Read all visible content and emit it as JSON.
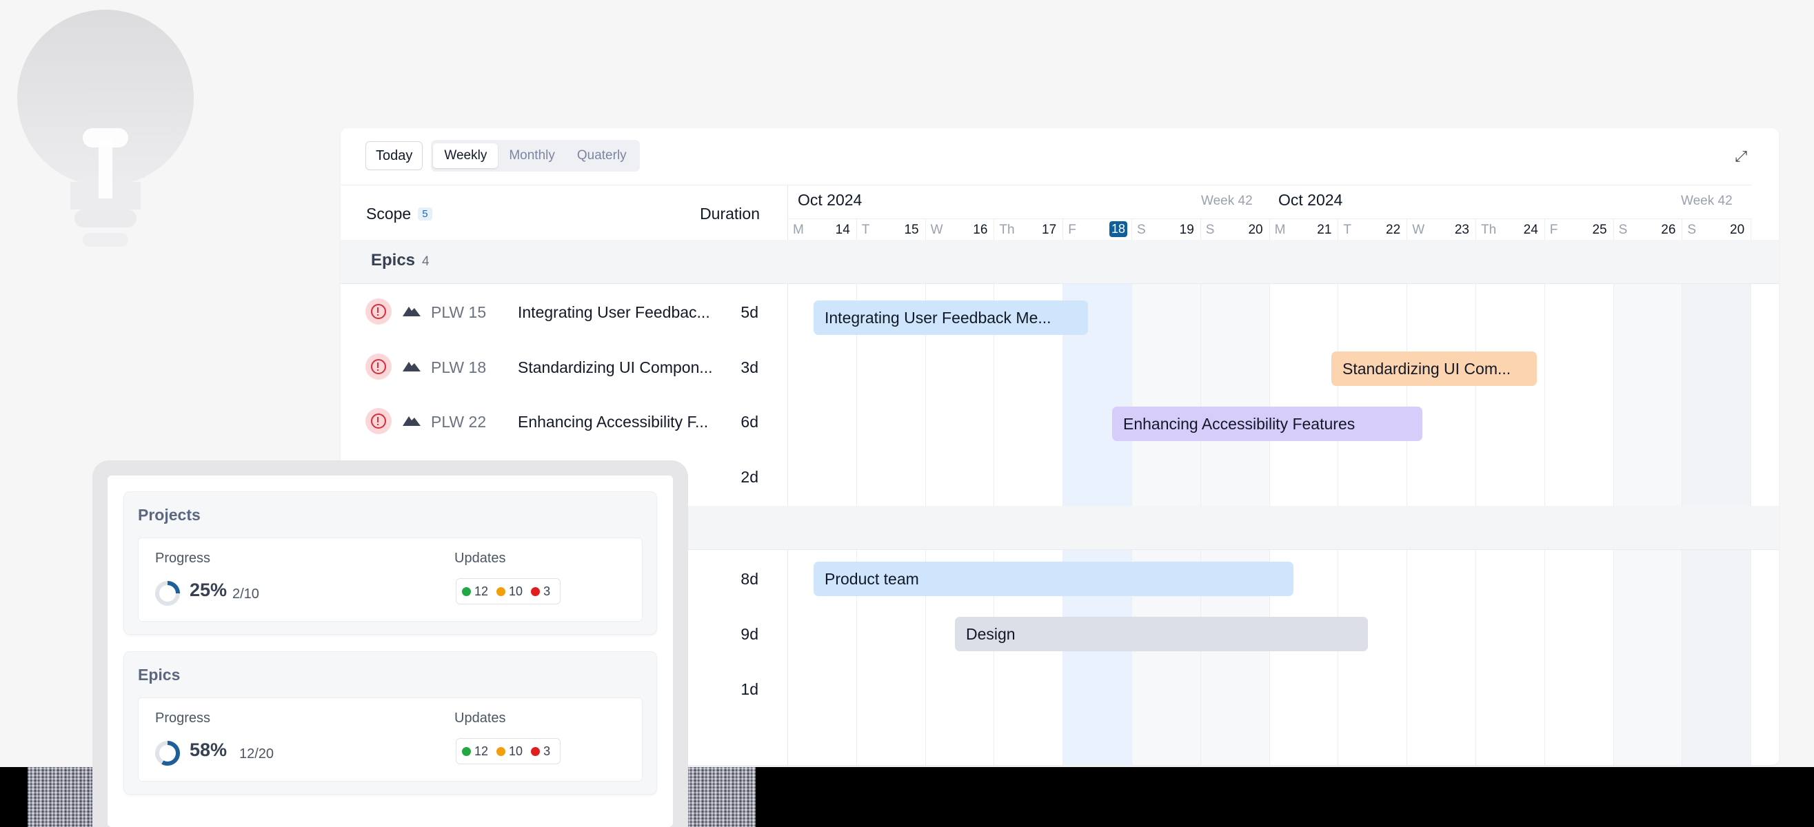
{
  "toolbar": {
    "today_label": "Today",
    "views": [
      "Weekly",
      "Monthly",
      "Quaterly"
    ],
    "active_view": "Weekly"
  },
  "scope": {
    "label": "Scope",
    "count": "5",
    "duration_label": "Duration"
  },
  "timeline": {
    "weeks": [
      {
        "month": "Oct 2024",
        "week": "Week 42"
      },
      {
        "month": "Oct 2024",
        "week": "Week 42"
      }
    ],
    "days": [
      {
        "l": "M",
        "n": "14"
      },
      {
        "l": "T",
        "n": "15"
      },
      {
        "l": "W",
        "n": "16"
      },
      {
        "l": "Th",
        "n": "17"
      },
      {
        "l": "F",
        "n": "18"
      },
      {
        "l": "S",
        "n": "19"
      },
      {
        "l": "S",
        "n": "20"
      },
      {
        "l": "M",
        "n": "21"
      },
      {
        "l": "T",
        "n": "22"
      },
      {
        "l": "W",
        "n": "23"
      },
      {
        "l": "Th",
        "n": "24"
      },
      {
        "l": "F",
        "n": "25"
      },
      {
        "l": "S",
        "n": "26"
      },
      {
        "l": "S",
        "n": "20"
      }
    ],
    "today_index": 4
  },
  "epics": {
    "title": "Epics",
    "count": "4",
    "rows": [
      {
        "key": "PLW 15",
        "name": "Integrating User Feedbac...",
        "duration": "5d"
      },
      {
        "key": "PLW 18",
        "name": "Standardizing UI Compon...",
        "duration": "3d"
      },
      {
        "key": "PLW 22",
        "name": "Enhancing Accessibility F...",
        "duration": "6d"
      },
      {
        "key": "",
        "name": "",
        "duration": "2d"
      }
    ]
  },
  "group2": {
    "rows": [
      {
        "duration": "8d"
      },
      {
        "duration": "9d"
      },
      {
        "duration": "1d"
      }
    ]
  },
  "bars": [
    {
      "label": "Integrating User Feedback Me...",
      "color": "#cfe5fb"
    },
    {
      "label": "Standardizing UI Com...",
      "color": "#fdd4b0"
    },
    {
      "label": "Enhancing Accessibility Features",
      "color": "#d6cdfa"
    },
    {
      "label": "Product team",
      "color": "#cfe5fb"
    },
    {
      "label": "Design",
      "color": "#dcdfe7"
    }
  ],
  "summary": {
    "projects": {
      "title": "Projects",
      "progress_label": "Progress",
      "percent": "25%",
      "progress_value": 0.25,
      "fraction": "2/10",
      "updates_label": "Updates",
      "updates": [
        {
          "v": "12",
          "color": "#22a843"
        },
        {
          "v": "10",
          "color": "#f59e0b"
        },
        {
          "v": "3",
          "color": "#e11d1d"
        }
      ]
    },
    "epics": {
      "title": "Epics",
      "progress_label": "Progress",
      "percent": "58%",
      "progress_value": 0.58,
      "fraction": "12/20",
      "updates_label": "Updates",
      "updates": [
        {
          "v": "12",
          "color": "#22a843"
        },
        {
          "v": "10",
          "color": "#f59e0b"
        },
        {
          "v": "3",
          "color": "#e11d1d"
        }
      ]
    }
  }
}
